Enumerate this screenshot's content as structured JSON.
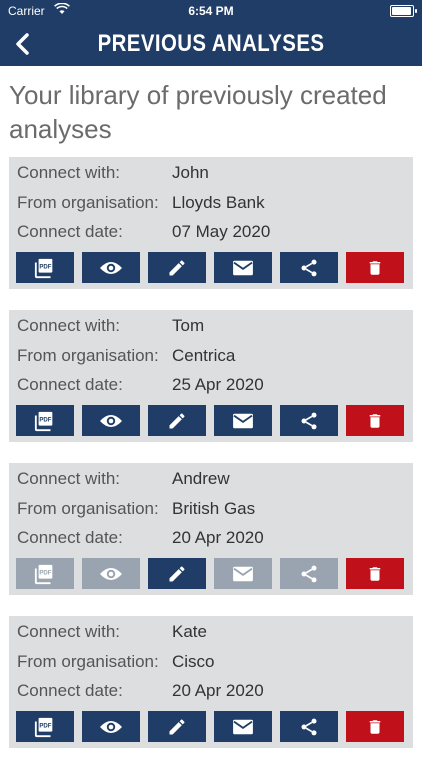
{
  "status_bar": {
    "carrier": "Carrier",
    "time": "6:54 PM"
  },
  "nav": {
    "title": "PREVIOUS ANALYSES",
    "back_icon": "back-chevron-icon"
  },
  "heading": "Your library of previously created analyses",
  "labels": {
    "connect_with": "Connect with:",
    "organisation": "From organisation:",
    "connect_date": "Connect date:"
  },
  "colors": {
    "primary": "#1f3d66",
    "disabled": "#9aa4b0",
    "delete": "#c0111b",
    "card": "#dddee0"
  },
  "actions": [
    "pdf-icon",
    "eye-icon",
    "pencil-icon",
    "mail-icon",
    "share-icon",
    "trash-icon"
  ],
  "analyses": [
    {
      "name": "John",
      "organisation": "Lloyds Bank",
      "date": "07 May 2020",
      "pdf_enabled": true
    },
    {
      "name": "Tom",
      "organisation": "Centrica",
      "date": "25 Apr 2020",
      "pdf_enabled": true
    },
    {
      "name": "Andrew",
      "organisation": "British Gas",
      "date": "20 Apr 2020",
      "pdf_enabled": false
    },
    {
      "name": "Kate",
      "organisation": "Cisco",
      "date": "20 Apr 2020",
      "pdf_enabled": true
    }
  ]
}
